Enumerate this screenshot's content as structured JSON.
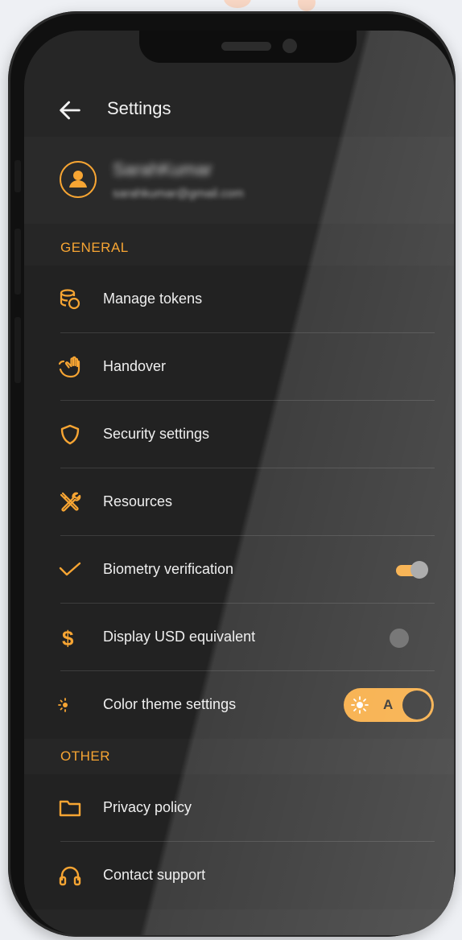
{
  "header": {
    "title": "Settings"
  },
  "profile": {
    "name": "SarahKumar",
    "email": "sarahkumar@gmail.com"
  },
  "sections": {
    "general": "GENERAL",
    "other": "OTHER"
  },
  "general_items": [
    {
      "label": "Manage tokens",
      "icon": "tokens-icon"
    },
    {
      "label": "Handover",
      "icon": "hand-icon"
    },
    {
      "label": "Security settings",
      "icon": "shield-icon"
    },
    {
      "label": "Resources",
      "icon": "tools-icon"
    },
    {
      "label": "Biometry verification",
      "icon": "check-icon",
      "toggle": true
    },
    {
      "label": "Display USD equivalent",
      "icon": "dollar-icon",
      "toggle": false
    },
    {
      "label": "Color theme settings",
      "icon": "theme-icon",
      "theme_option": "A"
    }
  ],
  "other_items": [
    {
      "label": "Privacy policy",
      "icon": "folder-icon"
    },
    {
      "label": "Contact support",
      "icon": "headset-icon"
    }
  ],
  "colors": {
    "accent": "#f7a533",
    "background": "#262626",
    "row": "#222222"
  }
}
